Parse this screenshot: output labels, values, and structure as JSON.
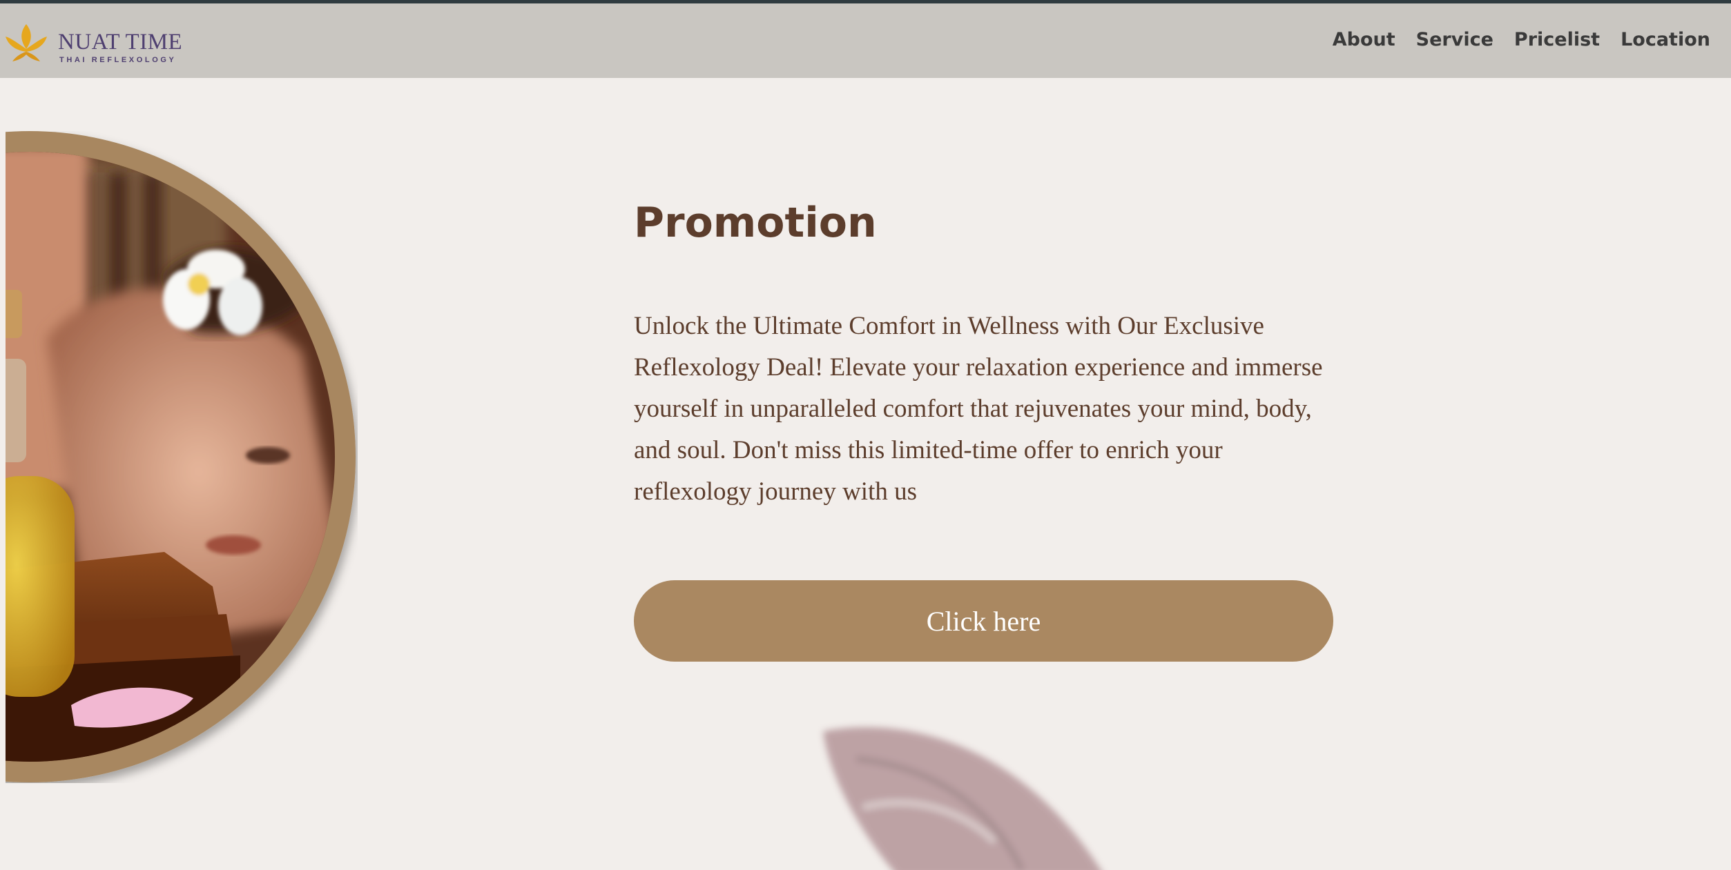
{
  "brand": {
    "name": "NUAT TIME",
    "tagline": "THAI REFLEXOLOGY",
    "logo_icon": "lotus-icon"
  },
  "nav": {
    "links": [
      "About",
      "Service",
      "Pricelist",
      "Location"
    ]
  },
  "hero": {
    "image": "spa-massage-photo"
  },
  "promotion": {
    "title": "Promotion",
    "description": "Unlock the Ultimate Comfort in Wellness with Our Exclusive Reflexology Deal! Elevate your relaxation experience and immerse yourself in unparalleled comfort that rejuvenates your mind, body, and soul. Don't miss this limited-time offer to enrich your reflexology journey with us",
    "button_label": "Click here"
  },
  "colors": {
    "background": "#f2eeeb",
    "navbar": "#c9c6c1",
    "accent": "#aa8861",
    "text": "#5c3d2c",
    "brand_text": "#4e3f70",
    "logo_gold": "#e6a71e"
  }
}
